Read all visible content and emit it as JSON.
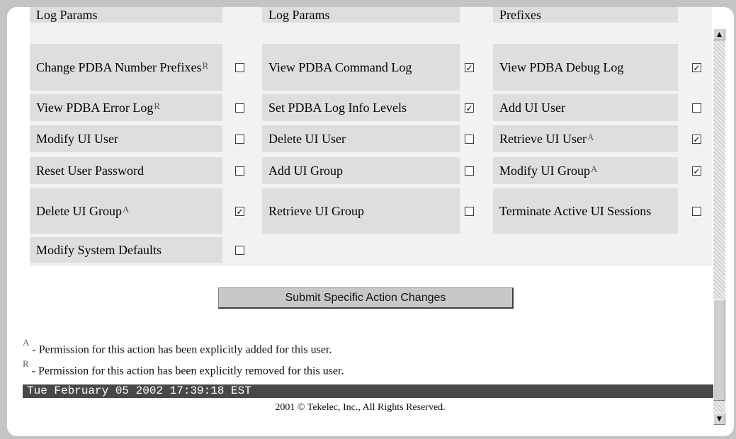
{
  "columns": [
    {
      "cells": [
        {
          "label": "Log Params",
          "sup": "",
          "checked": null
        },
        {
          "label": "Change PDBA Number Prefixes",
          "sup": "R",
          "checked": false
        },
        {
          "label": "View PDBA Error Log",
          "sup": "R",
          "checked": false
        },
        {
          "label": "Modify UI User",
          "sup": "",
          "checked": false
        },
        {
          "label": "Reset User Password",
          "sup": "",
          "checked": false
        },
        {
          "label": "Delete UI Group",
          "sup": "A",
          "checked": true
        },
        {
          "label": "Modify System Defaults",
          "sup": "",
          "checked": false
        }
      ]
    },
    {
      "cells": [
        {
          "label": "Log Params",
          "sup": "",
          "checked": null
        },
        {
          "label": "View PDBA Command Log",
          "sup": "",
          "checked": true
        },
        {
          "label": "Set PDBA Log Info Levels",
          "sup": "",
          "checked": true
        },
        {
          "label": "Delete UI User",
          "sup": "",
          "checked": false
        },
        {
          "label": "Add UI Group",
          "sup": "",
          "checked": false
        },
        {
          "label": "Retrieve UI Group",
          "sup": "",
          "checked": false
        }
      ]
    },
    {
      "cells": [
        {
          "label": "Prefixes",
          "sup": "",
          "checked": null
        },
        {
          "label": "View PDBA Debug Log",
          "sup": "",
          "checked": true
        },
        {
          "label": "Add UI User",
          "sup": "",
          "checked": false
        },
        {
          "label": "Retrieve UI User",
          "sup": "A",
          "checked": true
        },
        {
          "label": "Modify UI Group",
          "sup": "A",
          "checked": true
        },
        {
          "label": "Terminate Active UI Sessions",
          "sup": "",
          "checked": false
        }
      ]
    }
  ],
  "submit_label": "Submit Specific Action Changes",
  "legend": [
    {
      "mark": "A",
      "text": "- Permission for this action has been explicitly added for this user."
    },
    {
      "mark": "R",
      "text": "- Permission for this action has been explicitly removed for this user."
    }
  ],
  "status_datetime": "Tue February 05 2002 17:39:18 EST",
  "copyright": "2001 © Tekelec, Inc., All Rights Reserved.",
  "icons": {
    "scroll_up": "scroll-up-arrow-icon",
    "scroll_down": "scroll-down-arrow-icon"
  },
  "colors": {
    "cell_bg": "#dedede",
    "status_bar": "#484848",
    "page_bg": "#c4c4c4"
  }
}
